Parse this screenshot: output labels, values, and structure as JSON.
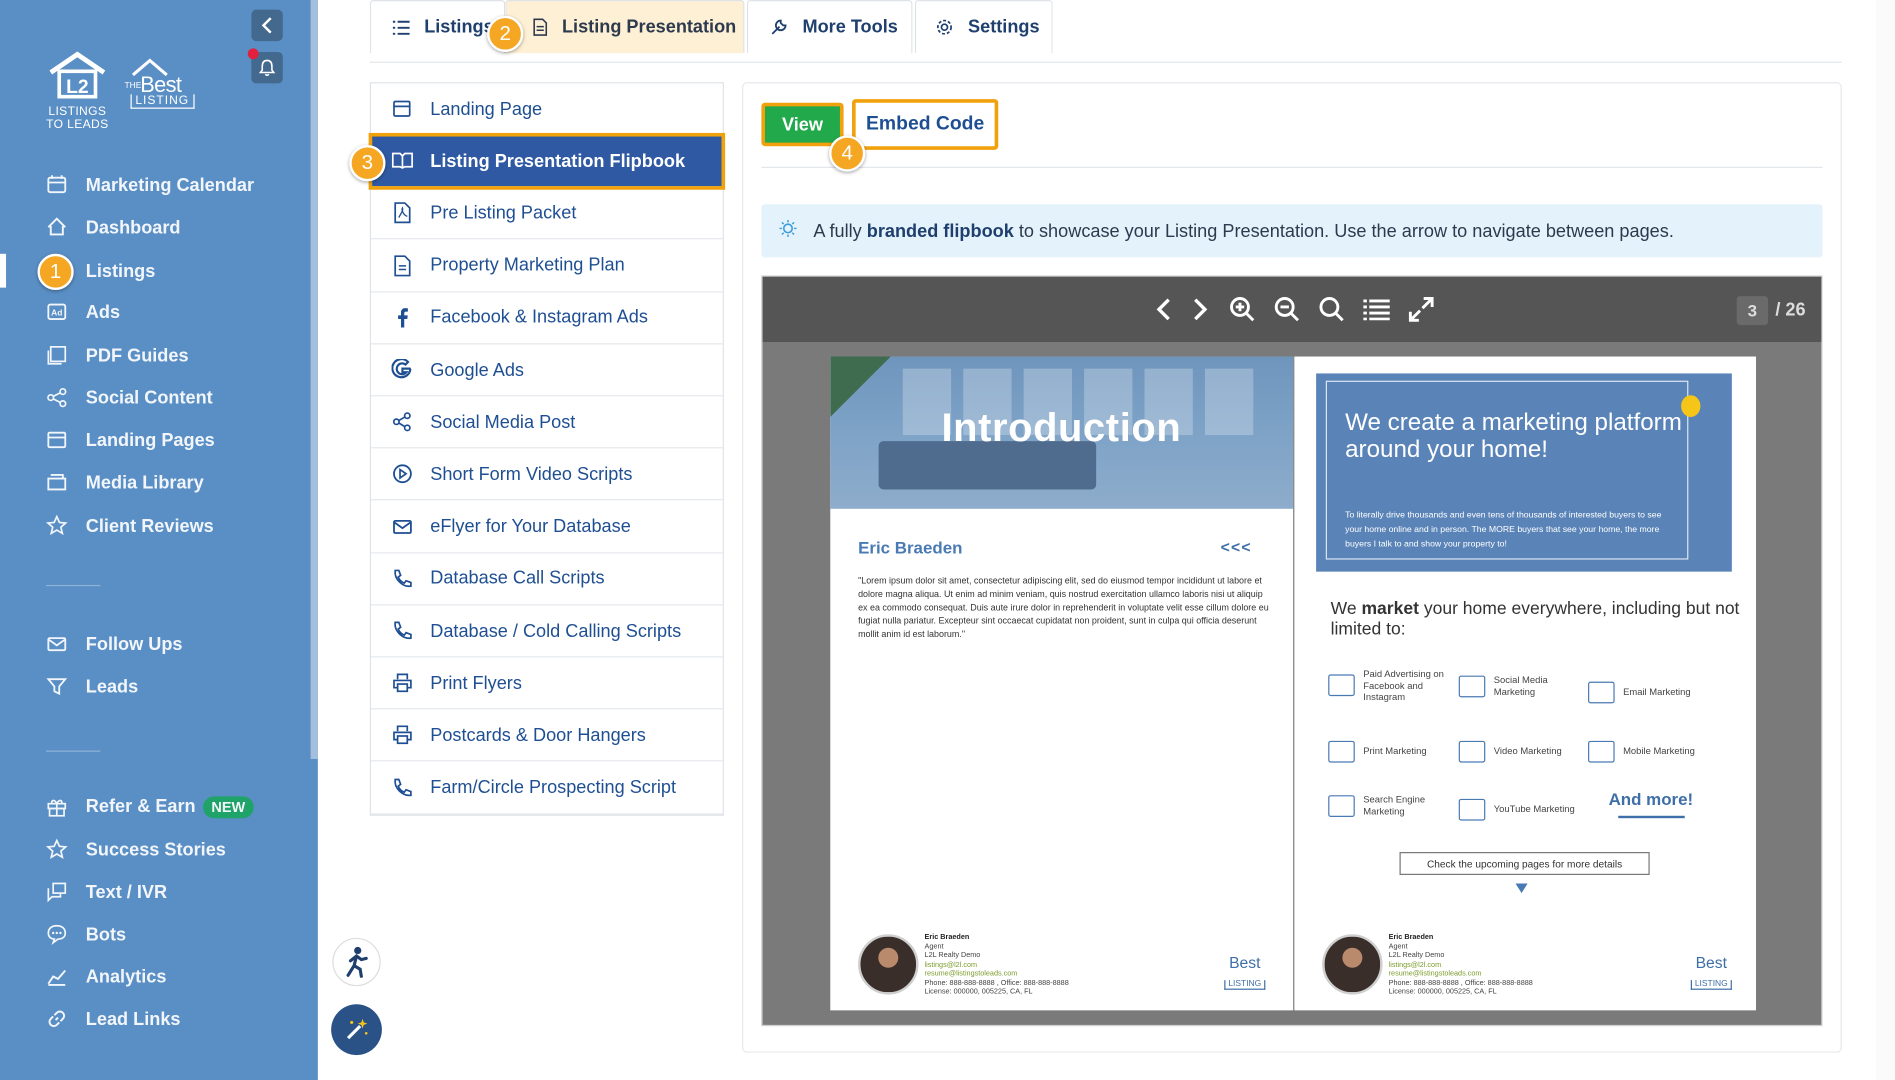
{
  "sidebar": {
    "logo_listings": "LISTINGS",
    "logo_to_leads": "TO LEADS",
    "logo_the": "THE",
    "logo_best": "Best",
    "logo_listing": "LISTING",
    "items": [
      {
        "label": "Marketing Calendar",
        "icon": "calendar-icon"
      },
      {
        "label": "Dashboard",
        "icon": "home-icon"
      },
      {
        "label": "Listings",
        "icon": "listings-icon",
        "active": true
      },
      {
        "label": "Ads",
        "icon": "ads-icon"
      },
      {
        "label": "PDF Guides",
        "icon": "pdf-icon"
      },
      {
        "label": "Social Content",
        "icon": "share-icon"
      },
      {
        "label": "Landing Pages",
        "icon": "page-icon"
      },
      {
        "label": "Media Library",
        "icon": "folder-icon"
      },
      {
        "label": "Client Reviews",
        "icon": "star-icon"
      },
      {
        "label": "Follow Ups",
        "icon": "mail-icon"
      },
      {
        "label": "Leads",
        "icon": "filter-icon"
      },
      {
        "label": "Refer & Earn",
        "icon": "gift-icon",
        "badge": "NEW"
      },
      {
        "label": "Success Stories",
        "icon": "star-icon"
      },
      {
        "label": "Text / IVR",
        "icon": "chat-icon"
      },
      {
        "label": "Bots",
        "icon": "bot-icon"
      },
      {
        "label": "Analytics",
        "icon": "analytics-icon"
      },
      {
        "label": "Lead Links",
        "icon": "link-icon"
      }
    ]
  },
  "steps": [
    "1",
    "2",
    "3",
    "4"
  ],
  "tabs": [
    {
      "label": "Listings",
      "icon": "list-icon"
    },
    {
      "label": "Listing Presentation",
      "icon": "document-icon",
      "active": true
    },
    {
      "label": "More Tools",
      "icon": "wrench-icon"
    },
    {
      "label": "Settings",
      "icon": "gear-icon"
    }
  ],
  "submenu": [
    {
      "label": "Landing Page",
      "icon": "window-icon"
    },
    {
      "label": "Listing Presentation Flipbook",
      "icon": "book-icon",
      "active": true
    },
    {
      "label": "Pre Listing Packet",
      "icon": "pdf-icon"
    },
    {
      "label": "Property Marketing Plan",
      "icon": "document-icon"
    },
    {
      "label": "Facebook & Instagram Ads",
      "icon": "facebook-icon"
    },
    {
      "label": "Google Ads",
      "icon": "google-icon"
    },
    {
      "label": "Social Media Post",
      "icon": "share-icon"
    },
    {
      "label": "Short Form Video Scripts",
      "icon": "play-icon"
    },
    {
      "label": "eFlyer for Your Database",
      "icon": "mail-icon"
    },
    {
      "label": "Database Call Scripts",
      "icon": "phone-icon"
    },
    {
      "label": "Database / Cold Calling Scripts",
      "icon": "phone-icon"
    },
    {
      "label": "Print Flyers",
      "icon": "printer-icon"
    },
    {
      "label": "Postcards & Door Hangers",
      "icon": "printer-icon"
    },
    {
      "label": "Farm/Circle Prospecting Script",
      "icon": "phone-icon"
    }
  ],
  "buttons": {
    "view": "View",
    "embed": "Embed Code"
  },
  "info": {
    "pre": "A fully ",
    "bold": "branded flipbook",
    "post": " to showcase your Listing Presentation. Use the arrow to navigate between pages."
  },
  "viewer": {
    "page": "3",
    "total": "/ 26"
  },
  "flipbook": {
    "left": {
      "title": "Introduction",
      "agent": "Eric Braeden",
      "arrows": "<<<",
      "lorem": "\"Lorem ipsum dolor sit amet, consectetur adipiscing elit, sed do eiusmod tempor incididunt ut labore et dolore magna aliqua. Ut enim ad minim veniam, quis nostrud exercitation ullamco laboris nisi ut aliquip ex ea commodo consequat. Duis aute irure dolor in reprehenderit in voluptate velit esse cillum dolore eu fugiat nulla pariatur. Excepteur sint occaecat cupidatat non proident, sunt in culpa qui officia deserunt mollit anim id est laborum.\""
    },
    "right": {
      "heading": "We create a marketing platform around your home!",
      "body": "To literally drive thousands and even tens of thousands of interested buyers to see your home online and in person. The MORE buyers that see your home, the more buyers I talk to and show your property to!",
      "market_pre": "We ",
      "market_bold": "market",
      "market_post": " your home everywhere, including but not limited to:",
      "services": [
        "Paid Advertising on Facebook and Instagram",
        "Social Media Marketing",
        "Email Marketing",
        "Print Marketing",
        "Video Marketing",
        "Mobile Marketing",
        "Search Engine Marketing",
        "YouTube Marketing"
      ],
      "and_more": "And more!",
      "check": "Check the upcoming pages for more details"
    },
    "footer": {
      "name": "Eric Braeden",
      "role": "Agent",
      "company": "L2L Realty Demo",
      "email": "listings@l2l.com",
      "email2": "resume@listingstoleads.com",
      "phone": "Phone: 888-888-8888 , Office: 888-888-8888",
      "license": "License: 000000, 005225, CA, FL"
    }
  }
}
